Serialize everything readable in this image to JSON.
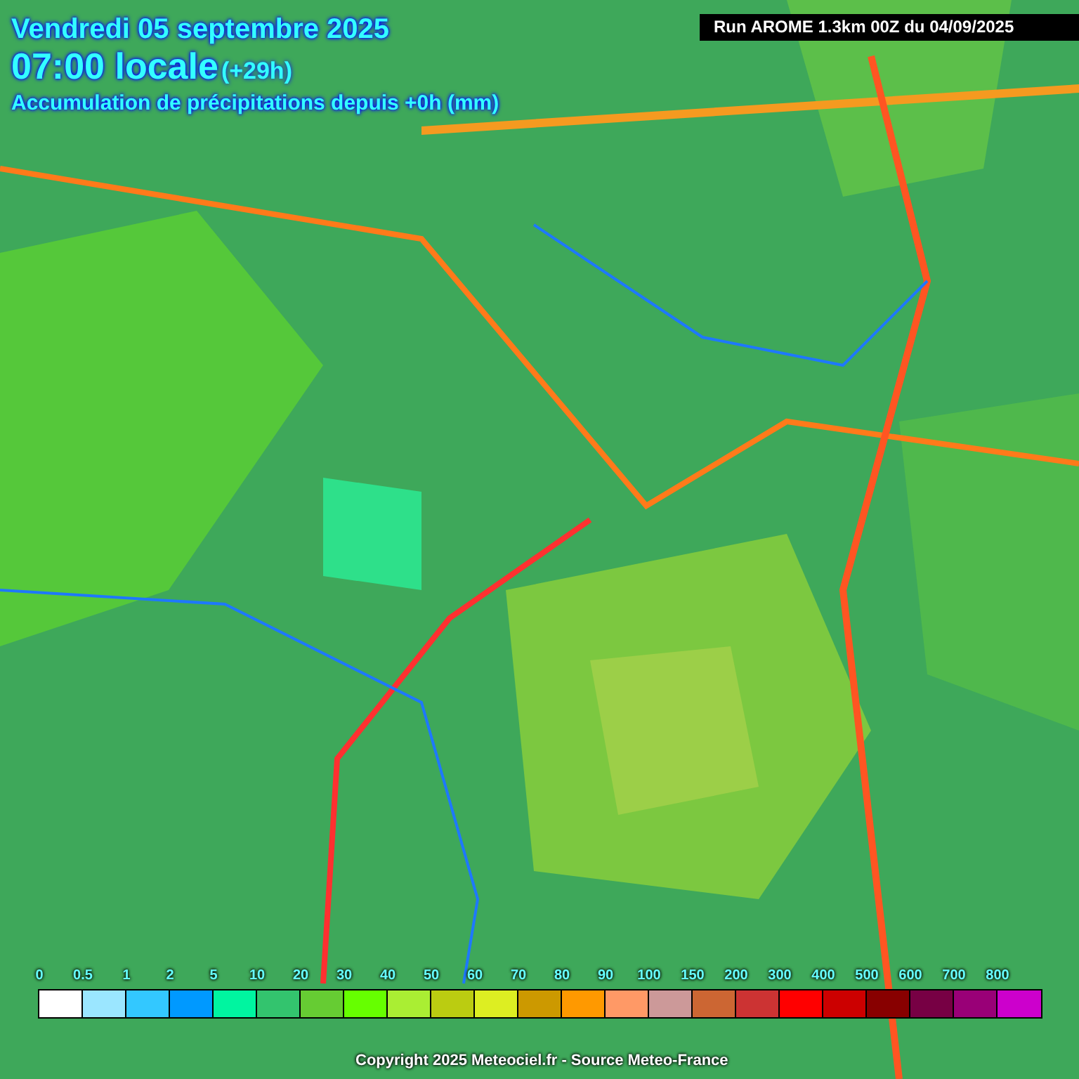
{
  "header": {
    "date": "Vendredi 05 septembre 2025",
    "time": "07:00 locale",
    "offset": "(+29h)",
    "subtitle": "Accumulation de précipitations depuis +0h (mm)"
  },
  "run_label": "Run AROME 1.3km 00Z du 04/09/2025",
  "legend": {
    "ticks": [
      "0",
      "0.5",
      "1",
      "2",
      "5",
      "10",
      "20",
      "30",
      "40",
      "50",
      "60",
      "70",
      "80",
      "90",
      "100",
      "150",
      "200",
      "300",
      "400",
      "500",
      "600",
      "700",
      "800"
    ],
    "swatches": [
      {
        "color": "#ffffff"
      },
      {
        "color": "#9be6ff"
      },
      {
        "color": "#33c8ff"
      },
      {
        "color": "#0099ff"
      },
      {
        "color": "#00f5a0"
      },
      {
        "color": "#33c46e"
      },
      {
        "color": "#66cc33"
      },
      {
        "color": "#66ff00"
      },
      {
        "color": "#aaee33"
      },
      {
        "color": "#bbcc11"
      },
      {
        "color": "#ddee22"
      },
      {
        "color": "#cc9900"
      },
      {
        "color": "#ff9900"
      },
      {
        "color": "#ff9966"
      },
      {
        "color": "#cc9999"
      },
      {
        "color": "#cc6633"
      },
      {
        "color": "#cc3333"
      },
      {
        "color": "#ff0000"
      },
      {
        "color": "#cc0000"
      },
      {
        "color": "#880000"
      },
      {
        "color": "#770044"
      },
      {
        "color": "#990077"
      },
      {
        "color": "#cc00cc"
      }
    ]
  },
  "copyright": "Copyright 2025 Meteociel.fr - Source Meteo-France"
}
